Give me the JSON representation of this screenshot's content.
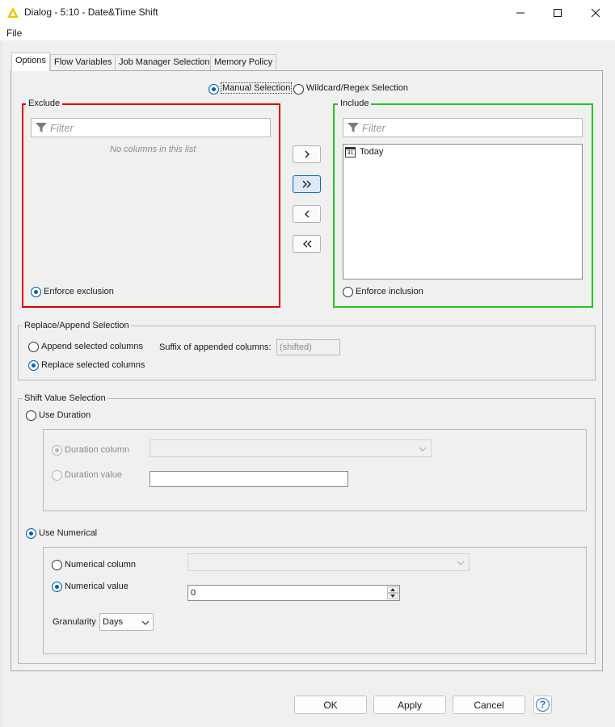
{
  "window": {
    "title": "Dialog - 5:10 - Date&Time Shift",
    "menu": "File"
  },
  "tabs": [
    "Options",
    "Flow Variables",
    "Job Manager Selection",
    "Memory Policy"
  ],
  "selection_mode": {
    "manual": "Manual Selection",
    "wildcard": "Wildcard/Regex Selection"
  },
  "exclude": {
    "title": "Exclude",
    "filter_placeholder": "Filter",
    "empty_text": "No columns in this list",
    "enforce_label": "Enforce exclusion"
  },
  "include": {
    "title": "Include",
    "filter_placeholder": "Filter",
    "items": [
      {
        "label": "Today",
        "icon": "calendar-icon",
        "icon_text": "31"
      }
    ],
    "enforce_label": "Enforce inclusion"
  },
  "replace_append": {
    "title": "Replace/Append Selection",
    "append_label": "Append selected columns",
    "replace_label": "Replace selected columns",
    "suffix_label": "Suffix of appended columns:",
    "suffix_value": "(shifted)"
  },
  "shift": {
    "title": "Shift Value Selection",
    "use_duration": "Use Duration",
    "duration_column": "Duration column",
    "duration_value": "Duration value",
    "use_numerical": "Use Numerical",
    "numerical_column": "Numerical column",
    "numerical_value": "Numerical value",
    "numerical_input": "0",
    "granularity_label": "Granularity",
    "granularity_value": "Days"
  },
  "buttons": {
    "ok": "OK",
    "apply": "Apply",
    "cancel": "Cancel",
    "help": "?"
  },
  "colors": {
    "accent": "#005fb8",
    "exclude_border": "#e00000",
    "include_border": "#1ec81e",
    "logo": "#f5c400"
  }
}
